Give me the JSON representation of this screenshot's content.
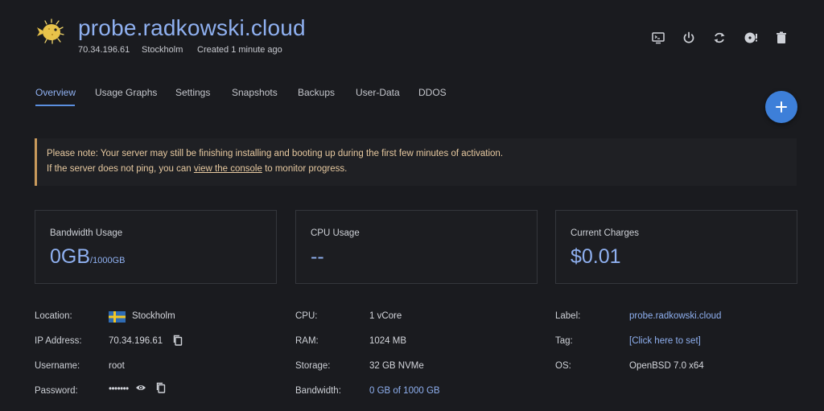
{
  "header": {
    "server_name": "probe.radkowski.cloud",
    "ip": "70.34.196.61",
    "location": "Stockholm",
    "created": "Created 1 minute ago"
  },
  "toolbar": {
    "icons": [
      "console-icon",
      "power-icon",
      "restart-icon",
      "reinstall-icon",
      "trash-icon"
    ]
  },
  "tabs": [
    {
      "label": "Overview",
      "active": true
    },
    {
      "label": "Usage Graphs"
    },
    {
      "label": "Settings"
    },
    {
      "label": "Snapshots"
    },
    {
      "label": "Backups"
    },
    {
      "label": "User-Data"
    },
    {
      "label": "DDOS"
    }
  ],
  "fab": {
    "label": "+"
  },
  "notice": {
    "line1": "Please note: Your server may still be finishing installing and booting up during the first few minutes of activation.",
    "line2_before": "If the server does not ping, you can ",
    "line2_link": "view the console",
    "line2_after": " to monitor progress."
  },
  "cards": {
    "bandwidth": {
      "title": "Bandwidth Usage",
      "value": "0GB",
      "suffix": "/1000GB"
    },
    "cpu": {
      "title": "CPU Usage",
      "value": "--"
    },
    "charges": {
      "title": "Current Charges",
      "value": "$0.01"
    }
  },
  "details": {
    "location": {
      "label": "Location:",
      "value": "Stockholm"
    },
    "ip": {
      "label": "IP Address:",
      "value": "70.34.196.61"
    },
    "username": {
      "label": "Username:",
      "value": "root"
    },
    "password": {
      "label": "Password:",
      "value": "•••••••"
    },
    "cpu": {
      "label": "CPU:",
      "value": "1 vCore"
    },
    "ram": {
      "label": "RAM:",
      "value": "1024 MB"
    },
    "storage": {
      "label": "Storage:",
      "value": "32 GB NVMe"
    },
    "bandwidth": {
      "label": "Bandwidth:",
      "value": "0 GB of 1000 GB"
    },
    "label": {
      "label": "Label:",
      "value": "probe.radkowski.cloud"
    },
    "tag": {
      "label": "Tag:",
      "value": "[Click here to set]"
    },
    "os": {
      "label": "OS:",
      "value": "OpenBSD 7.0 x64"
    }
  },
  "colors": {
    "background": "#1a1b1f",
    "accent": "#8fb0f0",
    "primary_button": "#3d7fd9",
    "notice_border": "#c99a5c",
    "notice_text": "#e7c9a0"
  }
}
